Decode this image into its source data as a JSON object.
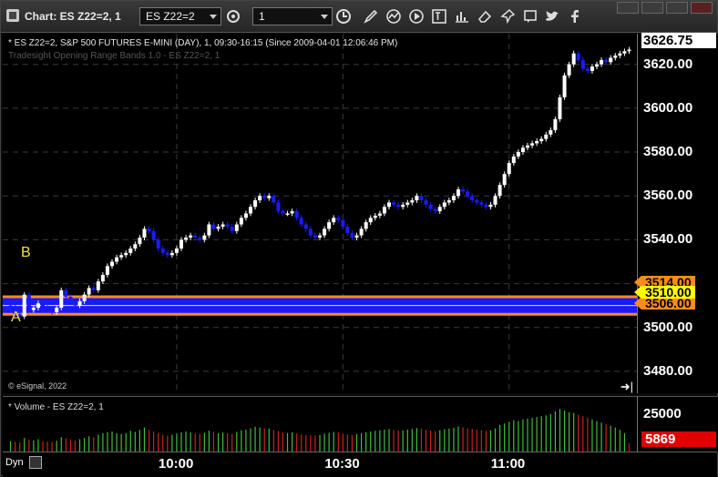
{
  "window": {
    "title": "Chart: ES Z22=2, 1",
    "symbol": "ES Z22=2",
    "interval": "1"
  },
  "toolbar": {
    "icons": [
      "settings-icon",
      "clock-icon",
      "pencil-icon",
      "indicator-icon",
      "play-icon",
      "text-icon",
      "eraser-icon",
      "notes-icon",
      "twitter-icon",
      "facebook-icon"
    ]
  },
  "chart": {
    "header": "* ES Z22=2, S&P 500 FUTURES E-MINI (DAY), 1, 09:30-16:15 (Since 2009-04-01 12:06:46 PM)",
    "study_label": "Tradesight Opening Range Bands 1.0 - ES Z22=2, 1",
    "copyright": "© eSignal, 2022",
    "label_a": "A",
    "label_b": "B",
    "last_price": "3626.75",
    "band_high": "3514.00",
    "band_mid": "3510.00",
    "band_low": "3506.00",
    "colors": {
      "up": "#ffffff",
      "down": "#1a1aff",
      "band": "#1a1aff",
      "band_edge": "#ff8c1a",
      "mid": "#ffff00"
    }
  },
  "volume": {
    "title": "* Volume - ES Z22=2, 1",
    "last_value": "5869",
    "tick": "25000"
  },
  "footer": {
    "dyn_label": "Dyn"
  },
  "chart_data": {
    "type": "candlestick",
    "title": "",
    "y_ticks": [
      "3480.00",
      "3500.00",
      "3520.00",
      "3540.00",
      "3560.00",
      "3580.00",
      "3600.00",
      "3620.00"
    ],
    "ylim": [
      3470,
      3634
    ],
    "x_ticks": [
      "10:00",
      "10:30",
      "11:00"
    ],
    "bands": {
      "high": 3514.0,
      "mid": 3510.0,
      "low": 3506.0
    },
    "closes": [
      3509,
      3506,
      3505,
      3515,
      3508,
      3509,
      3511,
      3509,
      3508,
      3507,
      3509,
      3517,
      3514,
      3512,
      3510,
      3512,
      3515,
      3518,
      3517,
      3521,
      3524,
      3528,
      3530,
      3532,
      3533,
      3534,
      3536,
      3538,
      3541,
      3545,
      3544,
      3540,
      3536,
      3534,
      3533,
      3534,
      3536,
      3540,
      3541,
      3542,
      3541,
      3540,
      3542,
      3547,
      3545,
      3546,
      3547,
      3546,
      3544,
      3547,
      3550,
      3552,
      3555,
      3558,
      3560,
      3559,
      3560,
      3557,
      3553,
      3552,
      3552,
      3553,
      3550,
      3547,
      3545,
      3542,
      3541,
      3542,
      3545,
      3548,
      3550,
      3549,
      3546,
      3543,
      3541,
      3542,
      3545,
      3548,
      3550,
      3551,
      3552,
      3555,
      3557,
      3556,
      3555,
      3556,
      3557,
      3558,
      3560,
      3558,
      3556,
      3554,
      3553,
      3555,
      3557,
      3558,
      3560,
      3563,
      3562,
      3560,
      3558,
      3557,
      3556,
      3555,
      3556,
      3560,
      3565,
      3570,
      3575,
      3578,
      3580,
      3582,
      3583,
      3584,
      3585,
      3586,
      3588,
      3590,
      3595,
      3605,
      3615,
      3620,
      3625,
      3622,
      3618,
      3617,
      3619,
      3620,
      3622,
      3621,
      3623,
      3624,
      3625,
      3626,
      3626.75
    ],
    "volumes": [
      7000,
      6500,
      6200,
      9000,
      8000,
      7500,
      8200,
      7000,
      6800,
      6500,
      7200,
      9500,
      8800,
      8000,
      7500,
      8200,
      9000,
      10000,
      9500,
      11000,
      12000,
      12500,
      13000,
      12000,
      11500,
      12000,
      13500,
      12800,
      14000,
      15500,
      14000,
      13000,
      12000,
      11000,
      10500,
      11000,
      11800,
      12500,
      13000,
      12400,
      12000,
      11600,
      12200,
      13500,
      12800,
      12000,
      12400,
      11800,
      11400,
      12800,
      13800,
      14200,
      15000,
      16000,
      15500,
      15000,
      14800,
      14000,
      13200,
      12600,
      12000,
      12400,
      11800,
      11200,
      10800,
      10600,
      10400,
      10800,
      11600,
      12200,
      12800,
      12400,
      11600,
      11200,
      10800,
      11400,
      12000,
      12600,
      13000,
      13400,
      13800,
      14200,
      14600,
      14000,
      13600,
      13800,
      14200,
      14600,
      15200,
      14600,
      14000,
      13600,
      13200,
      13800,
      14400,
      14800,
      15400,
      16200,
      15600,
      15000,
      14600,
      14200,
      13800,
      13400,
      13800,
      15000,
      17000,
      18000,
      19000,
      20000,
      19500,
      20500,
      21000,
      21500,
      22000,
      22500,
      23000,
      24000,
      25500,
      27000,
      26000,
      25000,
      24500,
      23500,
      22500,
      21500,
      20500,
      19500,
      18500,
      17500,
      16500,
      15500,
      14000,
      12000,
      5869
    ]
  }
}
